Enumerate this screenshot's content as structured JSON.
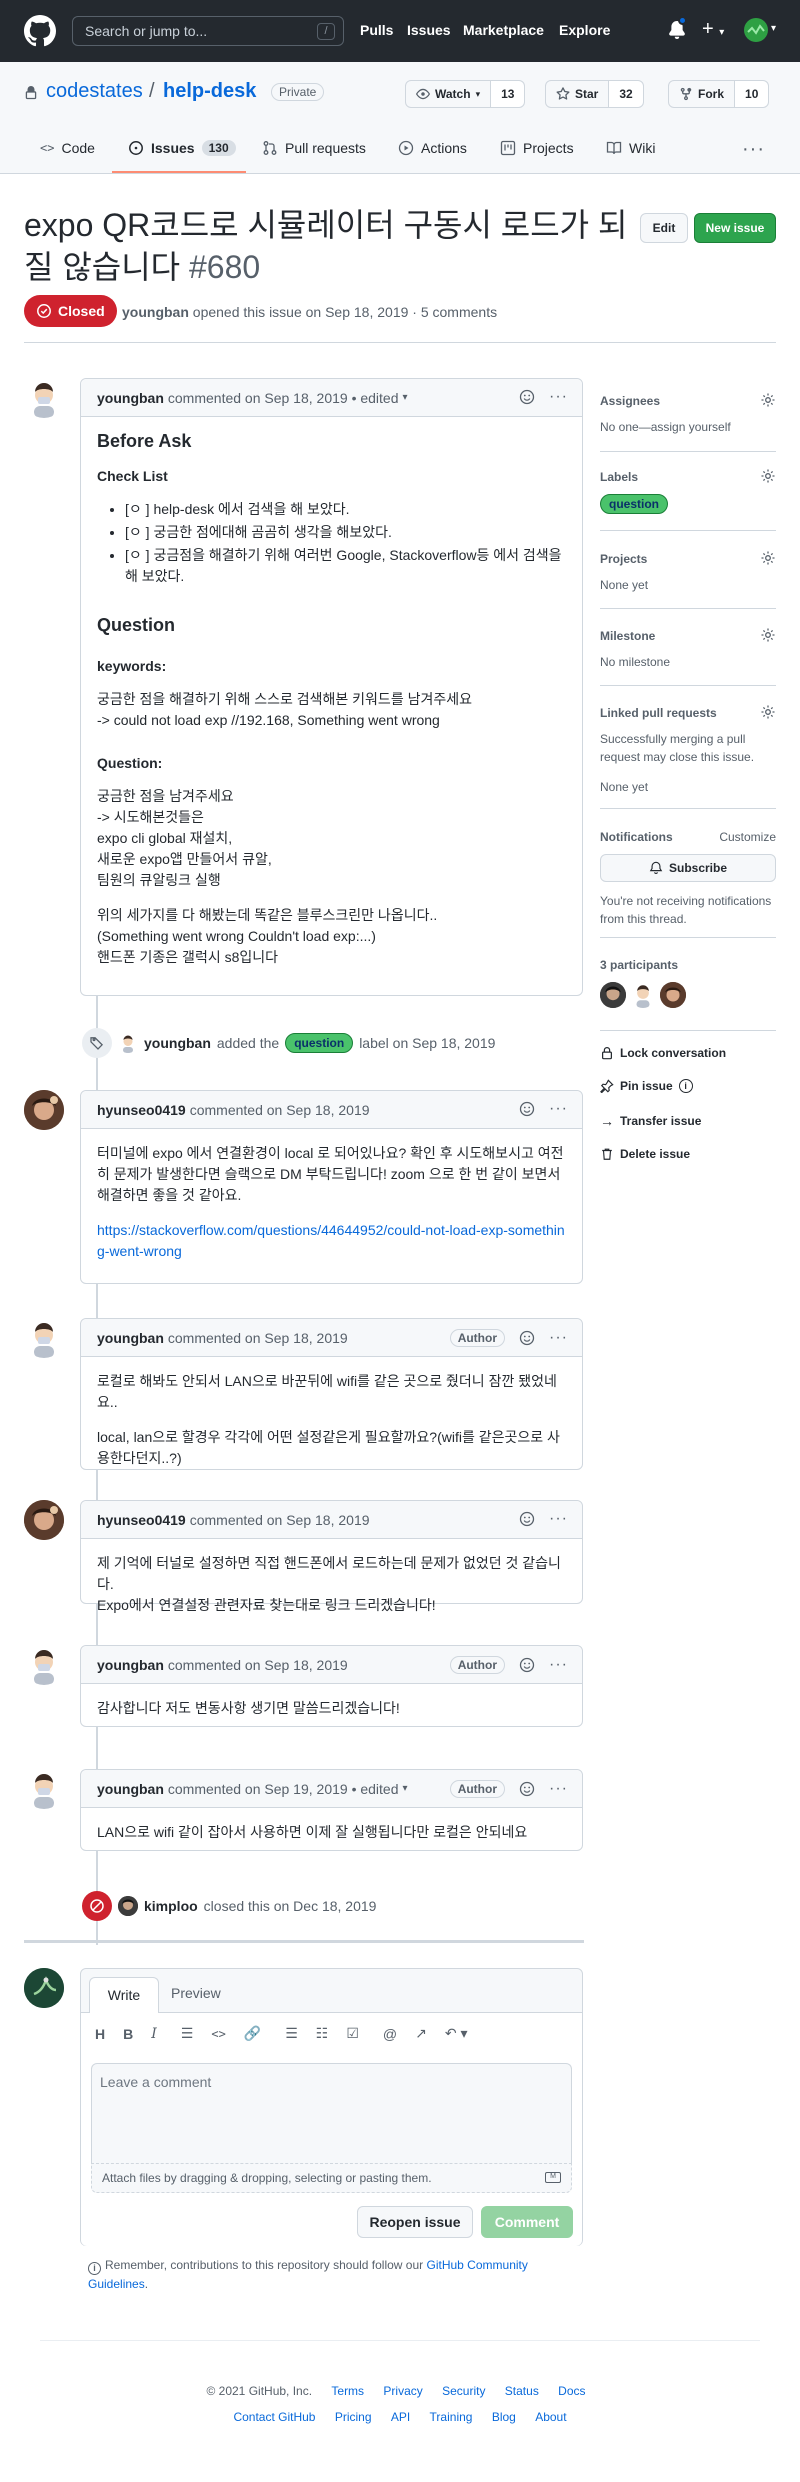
{
  "header": {
    "search_placeholder": "Search or jump to...",
    "search_key": "/",
    "nav": [
      "Pulls",
      "Issues",
      "Marketplace",
      "Explore"
    ]
  },
  "repo": {
    "owner": "codestates",
    "separator": "/",
    "name": "help-desk",
    "visibility": "Private",
    "watch_label": "Watch",
    "watch_count": "13",
    "star_label": "Star",
    "star_count": "32",
    "fork_label": "Fork",
    "fork_count": "10",
    "tabs": {
      "code": "Code",
      "issues": "Issues",
      "issues_count": "130",
      "pulls": "Pull requests",
      "actions": "Actions",
      "projects": "Projects",
      "wiki": "Wiki"
    }
  },
  "issue": {
    "title": "expo QR코드로 시뮬레이터 구동시 로드가 되질 않습니다",
    "number": "#680",
    "edit_label": "Edit",
    "new_issue_label": "New issue",
    "state": "Closed",
    "author": "youngban",
    "meta_rest": "opened this issue on Sep 18, 2019 · 5 comments"
  },
  "comments": {
    "c1": {
      "author": "youngban",
      "meta": "commented on Sep 18, 2019 • edited",
      "h_before_ask": "Before Ask",
      "h_checklist": "Check List",
      "checklist": [
        "[ㅇ ] help-desk 에서 검색을 해 보았다.",
        "[ㅇ ] 궁금한 점에대해 곰곰히 생각을 해보았다.",
        "[ㅇ ] 궁금점을 해결하기 위해 여러번 Google, Stackoverflow등 에서 검색을 해 보았다."
      ],
      "h_question": "Question",
      "h_keywords": "keywords:",
      "keywords_1": "궁금한 점을 해결하기 위해 스스로 검색해본 키워드를 남겨주세요",
      "keywords_2": "-> could not load exp //192.168, Something went wrong",
      "h_question2": "Question:",
      "q_lines": [
        "궁금한 점을 남겨주세요",
        "-> 시도해본것들은",
        "expo cli global 재설치,",
        "새로운 expo앱 만들어서 큐알,",
        "팀원의 큐알링크 실행"
      ],
      "tail_lines": [
        "위의 세가지를 다 해봤는데 똑같은 블루스크린만 나옵니다..",
        "(Something went wrong Couldn't load exp:...)",
        "핸드폰 기종은 갤럭시 s8입니다"
      ]
    },
    "label_event": {
      "actor": "youngban",
      "before": "added the",
      "label": "question",
      "after": "label on Sep 18, 2019"
    },
    "c2": {
      "author": "hyunseo0419",
      "meta": "commented on Sep 18, 2019",
      "body": "터미널에 expo 에서 연결환경이 local 로 되어있나요? 확인 후 시도해보시고 여전히 문제가 발생한다면 슬랙으로 DM 부탁드립니다! zoom 으로 한 번 같이 보면서 해결하면 좋을 것 같아요.",
      "link": "https://stackoverflow.com/questions/44644952/could-not-load-exp-something-went-wrong"
    },
    "c3": {
      "author": "youngban",
      "meta": "commented on Sep 18, 2019",
      "badge": "Author",
      "p1": "로컬로 해봐도 안되서 LAN으로 바꾼뒤에 wifi를 같은 곳으로 줬더니 잠깐 됐었네요..",
      "p2": "local, lan으로 할경우 각각에 어떤 설정같은게 필요할까요?(wifi를 같은곳으로 사용한다던지..?)"
    },
    "c4": {
      "author": "hyunseo0419",
      "meta": "commented on Sep 18, 2019",
      "l1": "제 기억에 터널로 설정하면 직접 핸드폰에서 로드하는데 문제가 없었던 것 같습니다.",
      "l2": "Expo에서 연결설정 관련자료 찾는대로 링크 드리겠습니다!"
    },
    "c5": {
      "author": "youngban",
      "meta": "commented on Sep 18, 2019",
      "badge": "Author",
      "body": "감사합니다 저도 변동사항 생기면 말씀드리겠습니다!"
    },
    "c6": {
      "author": "youngban",
      "meta": "commented on Sep 19, 2019 • edited",
      "badge": "Author",
      "body": "LAN으로 wifi 같이 잡아서 사용하면 이제 잘 실행됩니다만 로컬은 안되네요"
    },
    "close_event": {
      "actor": "kimploo",
      "text": "closed this on Dec 18, 2019"
    }
  },
  "composer": {
    "tab_write": "Write",
    "tab_preview": "Preview",
    "placeholder": "Leave a comment",
    "attach": "Attach files by dragging & dropping, selecting or pasting them.",
    "reopen": "Reopen issue",
    "comment": "Comment",
    "note_before": "Remember, contributions to this repository should follow our",
    "note_link": "GitHub Community Guidelines",
    "note_after": "."
  },
  "sidebar": {
    "assignees_title": "Assignees",
    "assignees_value": "No one—assign yourself",
    "labels_title": "Labels",
    "labels_value": "question",
    "projects_title": "Projects",
    "projects_value": "None yet",
    "milestone_title": "Milestone",
    "milestone_value": "No milestone",
    "linked_title": "Linked pull requests",
    "linked_desc": "Successfully merging a pull request may close this issue.",
    "linked_value": "None yet",
    "notifications_title": "Notifications",
    "customize": "Customize",
    "subscribe": "Subscribe",
    "notif_desc": "You're not receiving notifications from this thread.",
    "participants": "3 participants",
    "lock": "Lock conversation",
    "pin": "Pin issue",
    "transfer": "Transfer issue",
    "delete": "Delete issue"
  },
  "footer": {
    "copyright": "© 2021 GitHub, Inc.",
    "row1": [
      "Terms",
      "Privacy",
      "Security",
      "Status",
      "Docs"
    ],
    "row2": [
      "Contact GitHub",
      "Pricing",
      "API",
      "Training",
      "Blog",
      "About"
    ]
  },
  "colors": {
    "header_bg": "#24292f",
    "closed_red": "#cf222e",
    "new_issue_green": "#2da44e",
    "link_blue": "#0969da",
    "label_green": "#4ac26b"
  }
}
